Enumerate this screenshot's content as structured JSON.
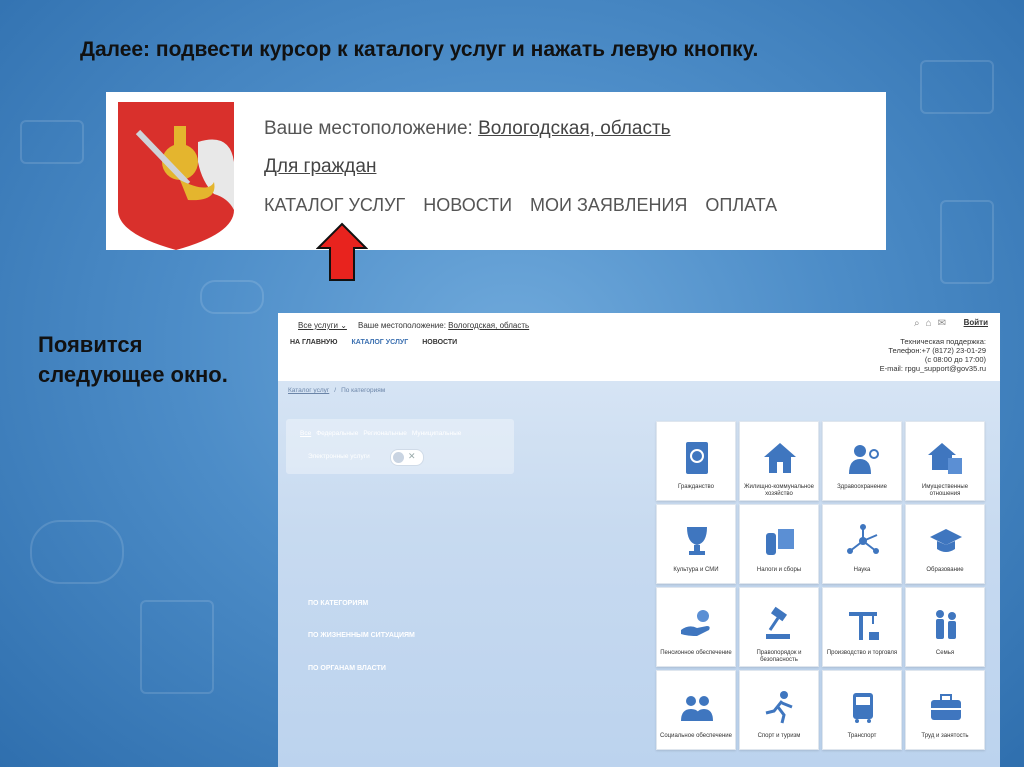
{
  "slide": {
    "title": "Далее: подвести курсор к каталогу услуг и нажать левую кнопку.",
    "note": "Появится следующее окно."
  },
  "top_crop": {
    "location_label": "Ваше местоположение:",
    "location_value": "Вологодская, область",
    "citizens_link": "Для граждан",
    "menu": [
      "КАТАЛОГ УСЛУГ",
      "НОВОСТИ",
      "МОИ ЗАЯВЛЕНИЯ",
      "ОПЛАТА"
    ]
  },
  "screenshot": {
    "header": {
      "all_services": "Все услуги",
      "location_label": "Ваше местоположение:",
      "location_value": "Вологодская, область",
      "login": "Войти",
      "nav": [
        "НА ГЛАВНУЮ",
        "КАТАЛОГ УСЛУГ",
        "НОВОСТИ"
      ],
      "support": "Техническая поддержка:\nТелефон:+7 (8172) 23-01-29\n(с 08:00 до 17:00)\nE-mail: rpgu_support@gov35.ru"
    },
    "breadcrumb": [
      "Каталог услуг",
      "/",
      "По категориям"
    ],
    "filters": [
      "Все",
      "Федеральные",
      "Региональные",
      "Муниципальные"
    ],
    "eservices_label": "Электронные услуги",
    "side_links": [
      "ПО КАТЕГОРИЯМ",
      "ПО ЖИЗНЕННЫМ СИТУАЦИЯМ",
      "ПО ОРГАНАМ ВЛАСТИ"
    ],
    "categories": [
      {
        "label": "Гражданство",
        "icon": "passport-icon"
      },
      {
        "label": "Жилищно-коммунальное хозяйство",
        "icon": "house-icon"
      },
      {
        "label": "Здравоохранение",
        "icon": "doctor-icon"
      },
      {
        "label": "Имущественные отношения",
        "icon": "property-icon"
      },
      {
        "label": "Культура и СМИ",
        "icon": "trophy-icon"
      },
      {
        "label": "Налоги и сборы",
        "icon": "coins-icon"
      },
      {
        "label": "Наука",
        "icon": "molecule-icon"
      },
      {
        "label": "Образование",
        "icon": "graduation-cap-icon"
      },
      {
        "label": "Пенсионное обеспечение",
        "icon": "hand-coin-icon"
      },
      {
        "label": "Правопорядок и безопасность",
        "icon": "gavel-icon"
      },
      {
        "label": "Производство и торговля",
        "icon": "crane-icon"
      },
      {
        "label": "Семья",
        "icon": "family-icon"
      },
      {
        "label": "Социальное обеспечение",
        "icon": "people-icon"
      },
      {
        "label": "Спорт и туризм",
        "icon": "runner-icon"
      },
      {
        "label": "Транспорт",
        "icon": "bus-icon"
      },
      {
        "label": "Труд и занятость",
        "icon": "briefcase-icon"
      }
    ]
  },
  "colors": {
    "accent": "#3a6fb0",
    "icon": "#3f76bf",
    "arrow": "#e8231e"
  }
}
